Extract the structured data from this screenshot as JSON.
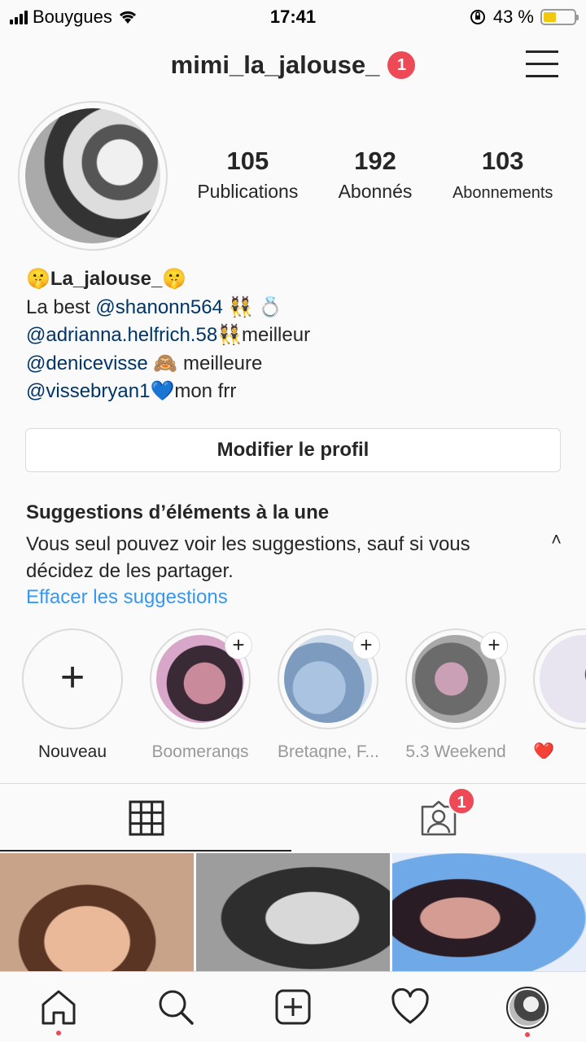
{
  "status_bar": {
    "carrier": "Bouygues",
    "time": "17:41",
    "battery_percent": "43 %",
    "battery_level": 0.43,
    "battery_color": "#f2c80f"
  },
  "header": {
    "username": "mimi_la_jalouse_",
    "notification_count": "1"
  },
  "profile": {
    "stats": [
      {
        "value": "105",
        "label": "Publications"
      },
      {
        "value": "192",
        "label": "Abonnés"
      },
      {
        "value": "103",
        "label": "Abonnements"
      }
    ],
    "bio": {
      "name": "🤫La_jalouse_🤫",
      "line1_text": "La best ",
      "line1_mention": "@shanonn564",
      "line1_emoji": " 👯 💍",
      "line2_mention": "@adrianna.helfrich.58",
      "line2_text": "👯meilleur",
      "line3_mention": "@denicevisse",
      "line3_text": " 🙈 meilleure",
      "line4_mention": "@vissebryan1",
      "line4_text": "💙mon frr"
    },
    "edit_button": "Modifier le profil"
  },
  "suggestions": {
    "title": "Suggestions d’éléments à la une",
    "description": "Vous seul pouvez voir les suggestions, sauf si vous décidez de les partager.",
    "clear_link": "Effacer les suggestions",
    "link_color": "#3897f0"
  },
  "highlights": [
    {
      "label": "Nouveau",
      "icon": "plus-icon"
    },
    {
      "label": "Boomerangs",
      "icon": "plus-icon"
    },
    {
      "label": "Bretagne, F...",
      "icon": "plus-icon"
    },
    {
      "label": "5.3 Weekend",
      "icon": "plus-icon"
    },
    {
      "label": "❤️",
      "icon": "plus-icon"
    }
  ],
  "tabs": {
    "grid": "grid-icon",
    "tagged": "tagged-person-icon",
    "tagged_notification": "1"
  },
  "bottom_nav": [
    "home-icon",
    "search-icon",
    "add-post-icon",
    "heart-icon",
    "profile-avatar"
  ],
  "accent_red": "#ed4956"
}
